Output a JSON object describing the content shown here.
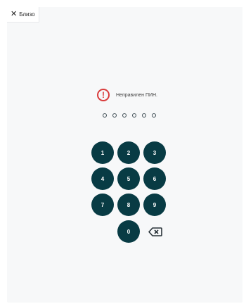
{
  "topbar": {
    "close_label": "Близо"
  },
  "pin": {
    "error_text": "Неправилен ПИН.",
    "dot_count": 6,
    "filled": 0
  },
  "keypad": {
    "keys": [
      "1",
      "2",
      "3",
      "4",
      "5",
      "6",
      "7",
      "8",
      "9",
      "0"
    ]
  },
  "colors": {
    "key_bg": "#083b44",
    "error": "#d93c3c"
  },
  "icons": {
    "close": "close-icon",
    "error": "alert-circle-icon",
    "backspace": "backspace-icon"
  }
}
